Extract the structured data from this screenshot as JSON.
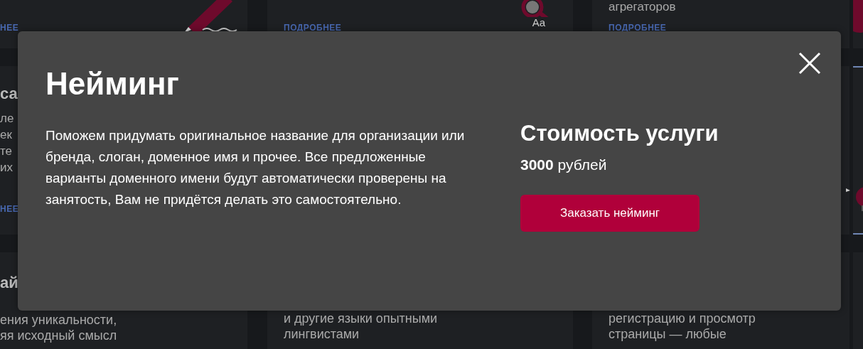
{
  "background_cards": {
    "top": [
      {
        "link": "НЕЕ"
      },
      {
        "link": "ПОДРОБНЕЕ",
        "icon_text": "Aa"
      },
      {
        "text": "агрегаторов",
        "link": "ПОДРОБНЕЕ"
      }
    ],
    "middle_left": {
      "title": "са",
      "lines": [
        "ле",
        "ек",
        "те",
        "их"
      ],
      "link": "НЕЕ"
    },
    "bottom": [
      {
        "title": "ай",
        "lines": [
          "ения уникальности,",
          "яя исходный смысл"
        ]
      },
      {
        "lines": [
          "и другие языки опытными",
          "лингвистами"
        ]
      },
      {
        "lines": [
          "регистрацию и просмотр",
          "страницы — любые"
        ]
      }
    ]
  },
  "modal": {
    "title": "Нейминг",
    "description": "Поможем придумать оригинальное название для организации или бренда, слоган, доменное имя и прочее. Все предложенные варианты доменного имени будут автоматически проверены на занятость, Вам не придётся делать это самостоятельно.",
    "price_title": "Стоимость услуги",
    "price": "**3000** рублей",
    "order_button": "Заказать нейминг"
  }
}
